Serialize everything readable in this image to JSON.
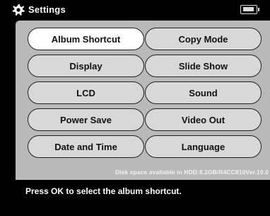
{
  "header": {
    "title": "Settings",
    "icon": "gear-icon",
    "battery_icon": "battery-icon"
  },
  "menu": {
    "items": [
      {
        "label": "Album Shortcut",
        "selected": true
      },
      {
        "label": "Copy Mode",
        "selected": false
      },
      {
        "label": "Display",
        "selected": false
      },
      {
        "label": "Slide Show",
        "selected": false
      },
      {
        "label": "LCD",
        "selected": false
      },
      {
        "label": "Sound",
        "selected": false
      },
      {
        "label": "Power Save",
        "selected": false
      },
      {
        "label": "Video Out",
        "selected": false
      },
      {
        "label": "Date and Time",
        "selected": false
      },
      {
        "label": "Language",
        "selected": false
      }
    ]
  },
  "status": {
    "disk_text": "Disk space available in HDD:8.2GB/R4CC810Ver.10.0"
  },
  "help": {
    "message": "Press OK to select the album shortcut."
  },
  "colors": {
    "panel_bg": "#b9b9b9",
    "button_bg": "#d8d8d8",
    "selected_bg": "#ffffff",
    "header_bg": "#000000"
  }
}
